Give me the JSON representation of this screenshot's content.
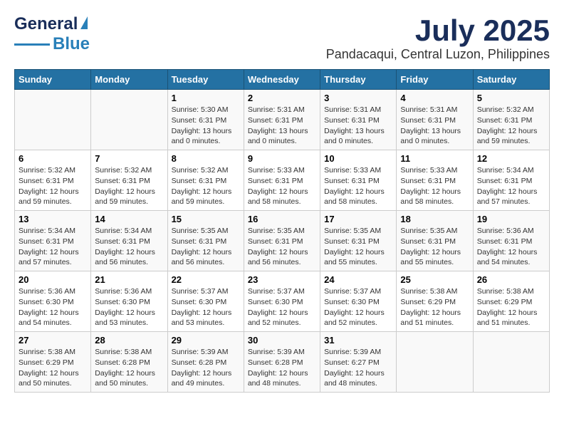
{
  "header": {
    "logo_line1": "General",
    "logo_line2": "Blue",
    "title": "July 2025",
    "subtitle": "Pandacaqui, Central Luzon, Philippines"
  },
  "calendar": {
    "headers": [
      "Sunday",
      "Monday",
      "Tuesday",
      "Wednesday",
      "Thursday",
      "Friday",
      "Saturday"
    ],
    "weeks": [
      [
        {
          "day": "",
          "info": ""
        },
        {
          "day": "",
          "info": ""
        },
        {
          "day": "1",
          "info": "Sunrise: 5:30 AM\nSunset: 6:31 PM\nDaylight: 13 hours\nand 0 minutes."
        },
        {
          "day": "2",
          "info": "Sunrise: 5:31 AM\nSunset: 6:31 PM\nDaylight: 13 hours\nand 0 minutes."
        },
        {
          "day": "3",
          "info": "Sunrise: 5:31 AM\nSunset: 6:31 PM\nDaylight: 13 hours\nand 0 minutes."
        },
        {
          "day": "4",
          "info": "Sunrise: 5:31 AM\nSunset: 6:31 PM\nDaylight: 13 hours\nand 0 minutes."
        },
        {
          "day": "5",
          "info": "Sunrise: 5:32 AM\nSunset: 6:31 PM\nDaylight: 12 hours\nand 59 minutes."
        }
      ],
      [
        {
          "day": "6",
          "info": "Sunrise: 5:32 AM\nSunset: 6:31 PM\nDaylight: 12 hours\nand 59 minutes."
        },
        {
          "day": "7",
          "info": "Sunrise: 5:32 AM\nSunset: 6:31 PM\nDaylight: 12 hours\nand 59 minutes."
        },
        {
          "day": "8",
          "info": "Sunrise: 5:32 AM\nSunset: 6:31 PM\nDaylight: 12 hours\nand 59 minutes."
        },
        {
          "day": "9",
          "info": "Sunrise: 5:33 AM\nSunset: 6:31 PM\nDaylight: 12 hours\nand 58 minutes."
        },
        {
          "day": "10",
          "info": "Sunrise: 5:33 AM\nSunset: 6:31 PM\nDaylight: 12 hours\nand 58 minutes."
        },
        {
          "day": "11",
          "info": "Sunrise: 5:33 AM\nSunset: 6:31 PM\nDaylight: 12 hours\nand 58 minutes."
        },
        {
          "day": "12",
          "info": "Sunrise: 5:34 AM\nSunset: 6:31 PM\nDaylight: 12 hours\nand 57 minutes."
        }
      ],
      [
        {
          "day": "13",
          "info": "Sunrise: 5:34 AM\nSunset: 6:31 PM\nDaylight: 12 hours\nand 57 minutes."
        },
        {
          "day": "14",
          "info": "Sunrise: 5:34 AM\nSunset: 6:31 PM\nDaylight: 12 hours\nand 56 minutes."
        },
        {
          "day": "15",
          "info": "Sunrise: 5:35 AM\nSunset: 6:31 PM\nDaylight: 12 hours\nand 56 minutes."
        },
        {
          "day": "16",
          "info": "Sunrise: 5:35 AM\nSunset: 6:31 PM\nDaylight: 12 hours\nand 56 minutes."
        },
        {
          "day": "17",
          "info": "Sunrise: 5:35 AM\nSunset: 6:31 PM\nDaylight: 12 hours\nand 55 minutes."
        },
        {
          "day": "18",
          "info": "Sunrise: 5:35 AM\nSunset: 6:31 PM\nDaylight: 12 hours\nand 55 minutes."
        },
        {
          "day": "19",
          "info": "Sunrise: 5:36 AM\nSunset: 6:31 PM\nDaylight: 12 hours\nand 54 minutes."
        }
      ],
      [
        {
          "day": "20",
          "info": "Sunrise: 5:36 AM\nSunset: 6:30 PM\nDaylight: 12 hours\nand 54 minutes."
        },
        {
          "day": "21",
          "info": "Sunrise: 5:36 AM\nSunset: 6:30 PM\nDaylight: 12 hours\nand 53 minutes."
        },
        {
          "day": "22",
          "info": "Sunrise: 5:37 AM\nSunset: 6:30 PM\nDaylight: 12 hours\nand 53 minutes."
        },
        {
          "day": "23",
          "info": "Sunrise: 5:37 AM\nSunset: 6:30 PM\nDaylight: 12 hours\nand 52 minutes."
        },
        {
          "day": "24",
          "info": "Sunrise: 5:37 AM\nSunset: 6:30 PM\nDaylight: 12 hours\nand 52 minutes."
        },
        {
          "day": "25",
          "info": "Sunrise: 5:38 AM\nSunset: 6:29 PM\nDaylight: 12 hours\nand 51 minutes."
        },
        {
          "day": "26",
          "info": "Sunrise: 5:38 AM\nSunset: 6:29 PM\nDaylight: 12 hours\nand 51 minutes."
        }
      ],
      [
        {
          "day": "27",
          "info": "Sunrise: 5:38 AM\nSunset: 6:29 PM\nDaylight: 12 hours\nand 50 minutes."
        },
        {
          "day": "28",
          "info": "Sunrise: 5:38 AM\nSunset: 6:28 PM\nDaylight: 12 hours\nand 50 minutes."
        },
        {
          "day": "29",
          "info": "Sunrise: 5:39 AM\nSunset: 6:28 PM\nDaylight: 12 hours\nand 49 minutes."
        },
        {
          "day": "30",
          "info": "Sunrise: 5:39 AM\nSunset: 6:28 PM\nDaylight: 12 hours\nand 48 minutes."
        },
        {
          "day": "31",
          "info": "Sunrise: 5:39 AM\nSunset: 6:27 PM\nDaylight: 12 hours\nand 48 minutes."
        },
        {
          "day": "",
          "info": ""
        },
        {
          "day": "",
          "info": ""
        }
      ]
    ]
  }
}
